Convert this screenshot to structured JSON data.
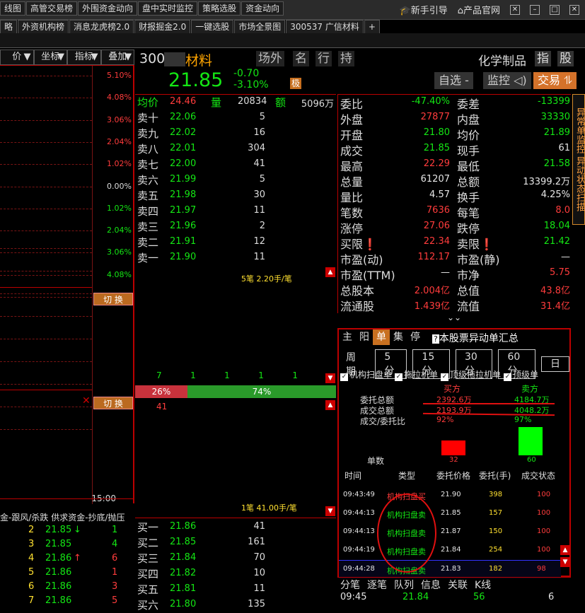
{
  "top_tabs_row1": [
    "线图",
    "高管交易榜",
    "外围资金动向",
    "盘中实时监控",
    "策略选股",
    "资金动向"
  ],
  "top_tabs_row2": [
    "略",
    "外资机构榜",
    "消息龙虎榜2.0",
    "财报掘金2.0",
    "一键选股",
    "市场全景图",
    "300537 广信材料",
    "+"
  ],
  "top_right": {
    "guide": "新手引导",
    "site": "产品官网"
  },
  "chart_menu": [
    "价",
    "坐标",
    "指标",
    "叠加"
  ],
  "left_pcts": [
    "5.10%",
    "4.08%",
    "3.06%",
    "2.04%",
    "1.02%",
    "0.00%",
    "1.02%",
    "2.04%",
    "3.06%",
    "4.08%",
    "5.10%"
  ],
  "qiehuan": "切 换",
  "left_time": "15:00",
  "left_list_header": "金-跟风/杀跌 供求资金-抄底/抛压",
  "left_list": [
    {
      "n": "2",
      "p": "21.85",
      "arrow": "↓",
      "v": "1",
      "pc": "grn",
      "vc": "grn"
    },
    {
      "n": "3",
      "p": "21.85",
      "arrow": "",
      "v": "4",
      "pc": "grn",
      "vc": "grn"
    },
    {
      "n": "4",
      "p": "21.86",
      "arrow": "↑",
      "v": "6",
      "pc": "grn",
      "vc": "red"
    },
    {
      "n": "5",
      "p": "21.86",
      "arrow": "",
      "v": "1",
      "pc": "grn",
      "vc": "red"
    },
    {
      "n": "6",
      "p": "21.86",
      "arrow": "",
      "v": "3",
      "pc": "grn",
      "vc": "red"
    },
    {
      "n": "7",
      "p": "21.86",
      "arrow": "",
      "v": "5",
      "pc": "grn",
      "vc": "red"
    }
  ],
  "quote": {
    "code": "300",
    "name": "材料",
    "tags": [
      "场外",
      "名",
      "行",
      "持"
    ],
    "price": "21.85",
    "chg": "-0.70",
    "chg_pct": "-3.10%",
    "ji": "极",
    "industry": "化学制品",
    "zhi": "指",
    "gu": "股",
    "btn_zixuan": "自选 -",
    "btn_jiankong": "监控 ◁)",
    "btn_trade": "交易 ⥮"
  },
  "book_head": {
    "avg_label": "均价",
    "avg": "24.46",
    "vol_label": "量",
    "vol": "20834",
    "amt_label": "额",
    "amt": "5096万"
  },
  "sell": [
    {
      "l": "卖十",
      "p": "22.06",
      "v": "5"
    },
    {
      "l": "卖九",
      "p": "22.02",
      "v": "16"
    },
    {
      "l": "卖八",
      "p": "22.01",
      "v": "304"
    },
    {
      "l": "卖七",
      "p": "22.00",
      "v": "41"
    },
    {
      "l": "卖六",
      "p": "21.99",
      "v": "5"
    },
    {
      "l": "卖五",
      "p": "21.98",
      "v": "30"
    },
    {
      "l": "卖四",
      "p": "21.97",
      "v": "11"
    },
    {
      "l": "卖三",
      "p": "21.96",
      "v": "2"
    },
    {
      "l": "卖二",
      "p": "21.91",
      "v": "12"
    },
    {
      "l": "卖一",
      "p": "21.90",
      "v": "11"
    }
  ],
  "buy": [
    {
      "l": "买一",
      "p": "21.86",
      "v": "41"
    },
    {
      "l": "买二",
      "p": "21.85",
      "v": "161"
    },
    {
      "l": "买三",
      "p": "21.84",
      "v": "70"
    },
    {
      "l": "买四",
      "p": "21.82",
      "v": "10"
    },
    {
      "l": "买五",
      "p": "21.81",
      "v": "11"
    },
    {
      "l": "买六",
      "p": "21.80",
      "v": "135"
    }
  ],
  "mid": {
    "top_note": "5笔 2.20手/笔",
    "counts": [
      "7",
      "1",
      "1",
      "1",
      "1"
    ],
    "bar_left": "26%",
    "bar_right": "74%",
    "bar_left_frac": 0.26,
    "left_num": "41",
    "bottom_note": "1笔 41.00手/笔"
  },
  "stats": [
    {
      "k1": "委比",
      "v1": "-47.40%",
      "c1": "grn",
      "k2": "委差",
      "v2": "-13399",
      "c2": "grn"
    },
    {
      "k1": "外盘",
      "v1": "27877",
      "c1": "red",
      "k2": "内盘",
      "v2": "33330",
      "c2": "grn"
    },
    {
      "k1": "开盘",
      "v1": "21.80",
      "c1": "grn",
      "k2": "均价",
      "v2": "21.89",
      "c2": "grn"
    },
    {
      "k1": "成交",
      "v1": "21.85",
      "c1": "grn",
      "k2": "现手",
      "v2": "61",
      "c2": "wht"
    },
    {
      "k1": "最高",
      "v1": "22.29",
      "c1": "red",
      "k2": "最低",
      "v2": "21.58",
      "c2": "grn"
    },
    {
      "k1": "总量",
      "v1": "61207",
      "c1": "wht",
      "k2": "总额",
      "v2": "13399.2万",
      "c2": "wht"
    },
    {
      "k1": "量比",
      "v1": "4.57",
      "c1": "wht",
      "k2": "换手",
      "v2": "4.25%",
      "c2": "wht"
    },
    {
      "k1": "笔数",
      "v1": "7636",
      "c1": "red",
      "k2": "每笔",
      "v2": "8.0",
      "c2": "red"
    },
    {
      "k1": "涨停",
      "v1": "27.06",
      "c1": "red",
      "k2": "跌停",
      "v2": "18.04",
      "c2": "grn"
    },
    {
      "k1": "买限❗",
      "v1": "22.34",
      "c1": "red",
      "k2": "卖限❗",
      "v2": "21.42",
      "c2": "grn"
    },
    {
      "k1": "市盈(动)",
      "v1": "112.17",
      "c1": "red",
      "k2": "市盈(静)",
      "v2": "—",
      "c2": "wht"
    },
    {
      "k1": "市盈(TTM)",
      "v1": "—",
      "c1": "wht",
      "k2": "市净",
      "v2": "5.75",
      "c2": "red"
    },
    {
      "k1": "总股本",
      "v1": "2.004亿",
      "c1": "red",
      "k2": "总值",
      "v2": "43.8亿",
      "c2": "red"
    },
    {
      "k1": "流通股",
      "v1": "1.439亿",
      "c1": "red",
      "k2": "流值",
      "v2": "31.4亿",
      "c2": "red"
    }
  ],
  "side_tab": "异常单监控 异动状态扫描",
  "anomaly": {
    "tabs": [
      "主",
      "阳",
      "单",
      "集",
      "停"
    ],
    "title": "本股票异动单汇总",
    "period_label": "周期",
    "periods": [
      "5分",
      "15分",
      "30分",
      "60分",
      "日"
    ],
    "checks": [
      "机构扫盘单",
      "拖拉机单",
      "顶级拖拉机单",
      "顶级单"
    ],
    "buy_label": "买方",
    "sell_label": "卖方",
    "rows": [
      {
        "k": "委托总额",
        "b": "2392.6万",
        "s": "4184.7万"
      },
      {
        "k": "成交总额",
        "b": "2193.9万",
        "s": "4048.2万"
      },
      {
        "k": "成交/委托比",
        "b": "92%",
        "s": "97%"
      }
    ],
    "count_label": "单数",
    "buy_count": "32",
    "sell_count": "60",
    "buy_count_n": 32,
    "sell_count_n": 60,
    "headers": [
      "时间",
      "类型",
      "委托价格",
      "委托(手)",
      "成交状态"
    ],
    "list": [
      {
        "t": "09:43:49",
        "type": "机构扫盘买",
        "p": "21.90",
        "q": "398",
        "s": "100",
        "c": "red"
      },
      {
        "t": "09:44:13",
        "type": "机构扫盘卖",
        "p": "21.85",
        "q": "157",
        "s": "100",
        "c": "grn"
      },
      {
        "t": "09:44:13",
        "type": "机构扫盘卖",
        "p": "21.87",
        "q": "150",
        "s": "100",
        "c": "grn"
      },
      {
        "t": "09:44:19",
        "type": "机构扫盘卖",
        "p": "21.84",
        "q": "254",
        "s": "100",
        "c": "grn"
      },
      {
        "t": "09:44:28",
        "type": "机构扫盘卖",
        "p": "21.83",
        "q": "182",
        "s": "98",
        "c": "grn"
      }
    ]
  },
  "bottom": {
    "tabs": [
      "分笔",
      "逐笔",
      "队列",
      "信息",
      "关联",
      "K线"
    ],
    "time": "09:45",
    "price": "21.84",
    "vol": "56",
    "n": "6"
  },
  "colors": {
    "up": "#ff3c3c",
    "down": "#14e614",
    "accent": "#c87020",
    "border": "#b00000"
  }
}
